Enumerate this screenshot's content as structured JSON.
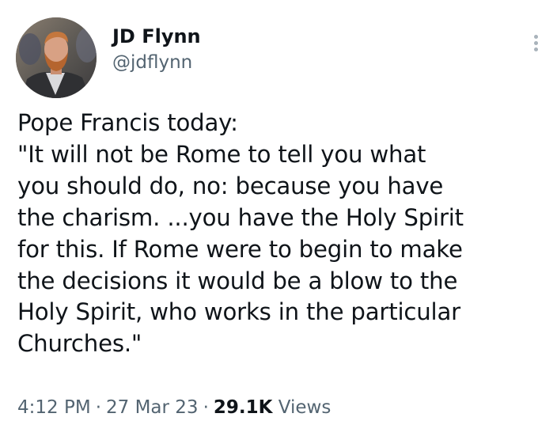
{
  "author": {
    "display_name": "JD Flynn",
    "handle": "@jdflynn"
  },
  "tweet": {
    "lines": [
      "Pope Francis today:",
      "\"It will not be Rome to tell you what",
      "you should do, no: because you have",
      "the charism. ...you have the Holy Spirit",
      "for this. If Rome were to begin to make",
      "the decisions it would be a blow to the",
      "Holy Spirit, who works in the particular",
      "Churches.\""
    ]
  },
  "meta": {
    "time": "4:12 PM",
    "separator": "·",
    "date": "27 Mar 23",
    "views_count": "29.1K",
    "views_label": "Views"
  },
  "icons": {
    "more": "more-options-icon",
    "avatar": "profile-avatar"
  },
  "colors": {
    "text_primary": "#0f1419",
    "text_secondary": "#536471",
    "background": "#ffffff"
  }
}
